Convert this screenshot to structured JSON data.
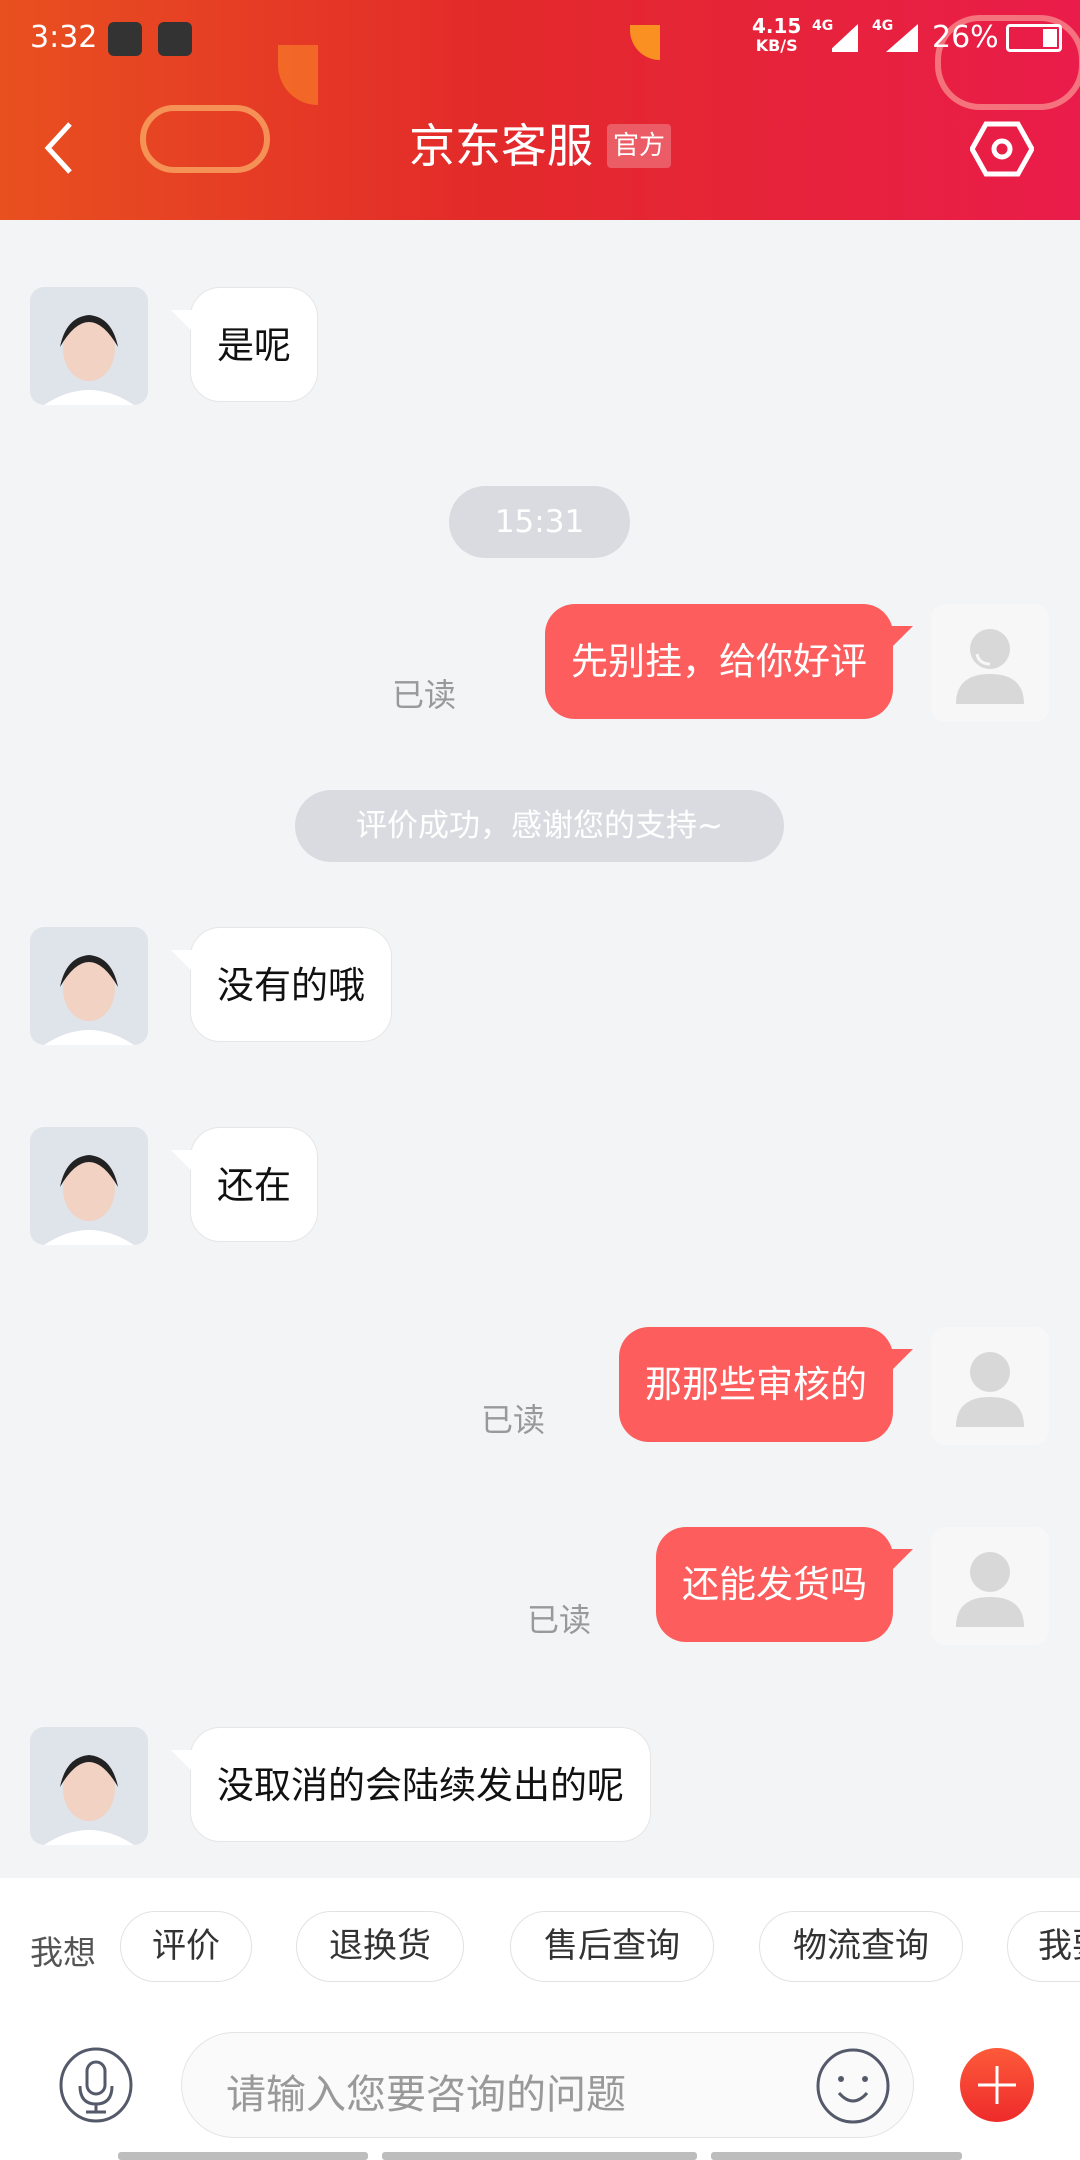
{
  "status_bar": {
    "time": "3:32",
    "net_speed": "4.15",
    "net_unit": "KB/S",
    "signal1": "4G",
    "signal2": "4G",
    "battery": "26%"
  },
  "header": {
    "title": "京东客服",
    "badge": "官方",
    "back_icon": "chevron-left-icon",
    "settings_icon": "hexagon-gear-icon"
  },
  "messages": [
    {
      "side": "recv",
      "text": "是呢"
    },
    {
      "type": "time",
      "text": "15:31"
    },
    {
      "side": "sent",
      "text": "先别挂，给你好评",
      "status": "已读"
    },
    {
      "type": "system",
      "text": "评价成功，感谢您的支持~"
    },
    {
      "side": "recv",
      "text": "没有的哦"
    },
    {
      "side": "recv",
      "text": "还在"
    },
    {
      "side": "sent",
      "text": "那那些审核的",
      "status": "已读"
    },
    {
      "side": "sent",
      "text": "还能发货吗",
      "status": "已读"
    },
    {
      "side": "recv",
      "text": "没取消的会陆续发出的呢"
    }
  ],
  "quick": {
    "label": "我想",
    "chips": [
      "评价",
      "退换货",
      "售后查询",
      "物流查询",
      "我要"
    ]
  },
  "input": {
    "placeholder": "请输入您要咨询的问题"
  },
  "colors": {
    "accent": "#fd5d5d",
    "header_start": "#e8501f",
    "header_end": "#ea1c4a"
  }
}
